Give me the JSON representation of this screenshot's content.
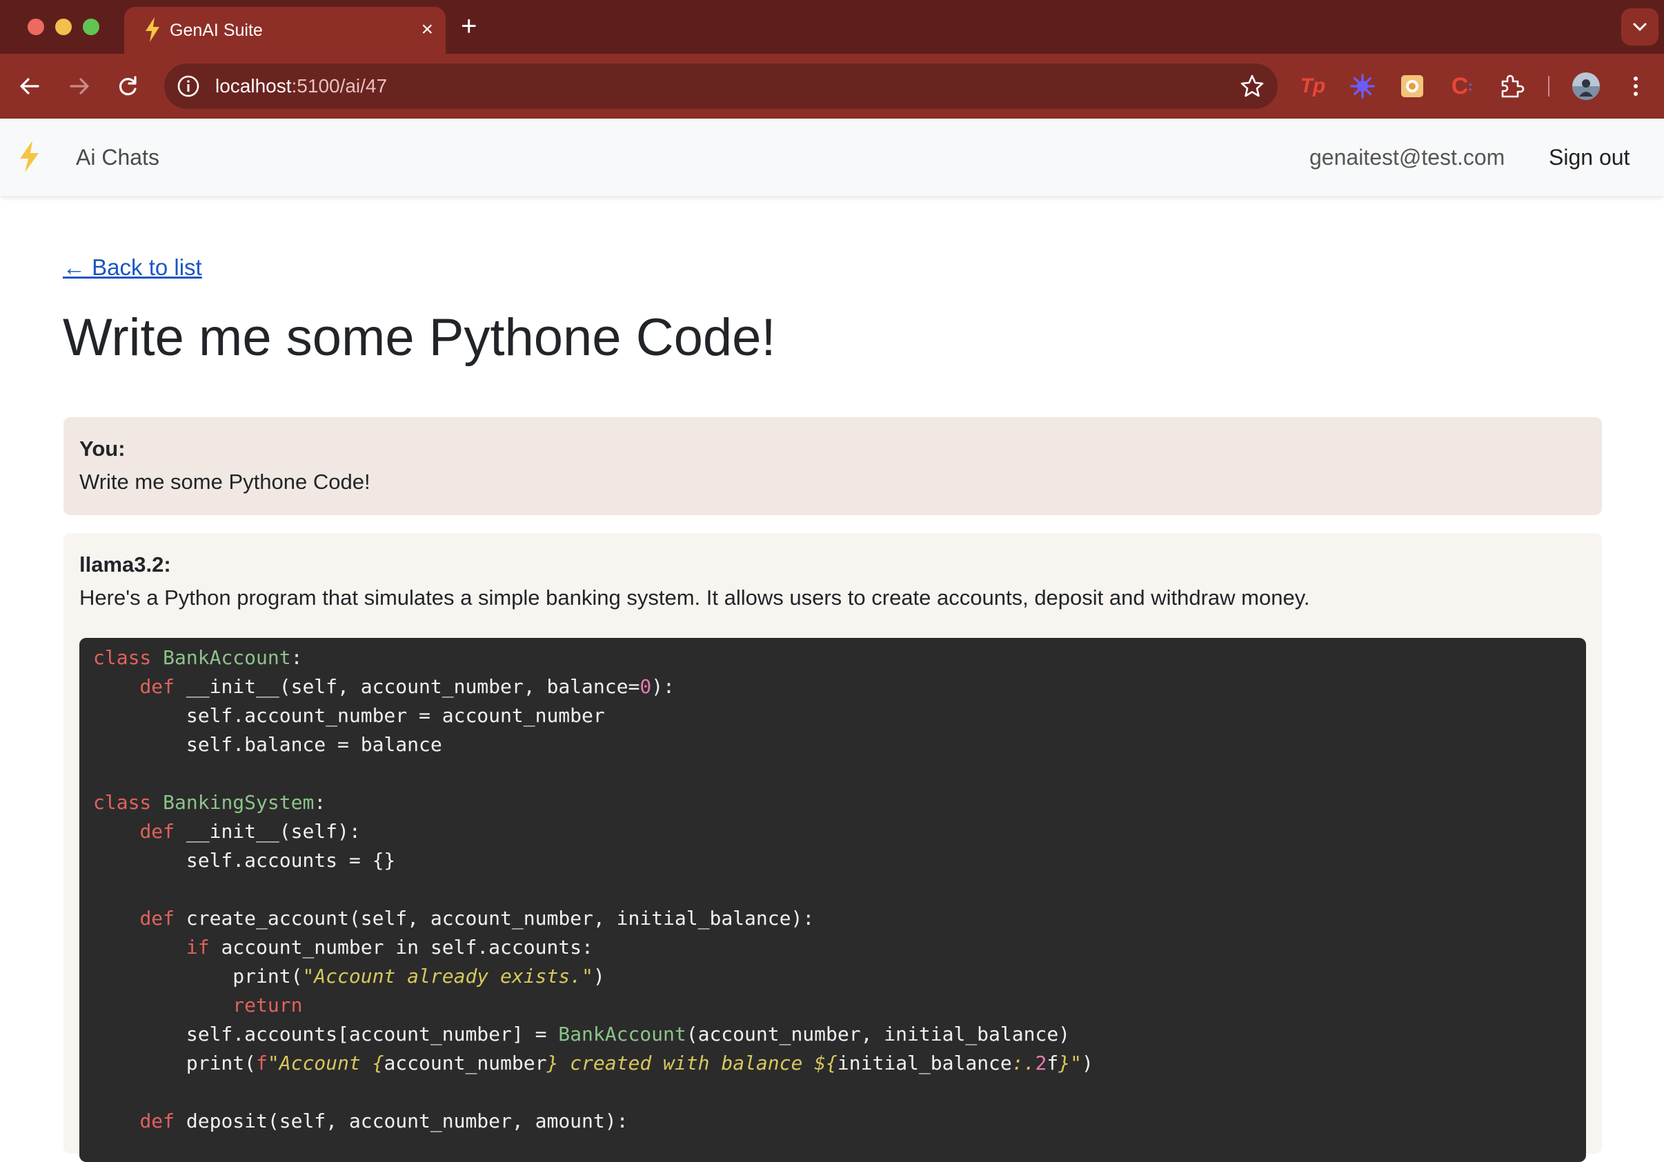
{
  "browser": {
    "tab_title": "GenAI Suite",
    "tab_close": "×",
    "new_tab": "+",
    "url_host": "localhost",
    "url_path": ":5100/ai/47",
    "extensions": [
      "tp-extension-icon",
      "sunburst-extension-icon",
      "camera-extension-icon",
      "c-extension-icon",
      "puzzle-extension-icon",
      "profile-avatar"
    ]
  },
  "appbar": {
    "nav_label": "Ai Chats",
    "user_email": "genaitest@test.com",
    "signout_label": "Sign out"
  },
  "main": {
    "back_label": "← Back to list",
    "title": "Write me some Pythone Code!"
  },
  "messages": {
    "user": {
      "label": "You:",
      "text": "Write me some Pythone Code!"
    },
    "ai": {
      "label": "llama3.2:",
      "text": "Here's a Python program that simulates a simple banking system. It allows users to create accounts, deposit and withdraw money."
    }
  },
  "code_lines": [
    [
      [
        "kw",
        "class "
      ],
      [
        "cls",
        "BankAccount"
      ],
      [
        "p",
        ":"
      ]
    ],
    [
      [
        "p",
        "    "
      ],
      [
        "kw",
        "def "
      ],
      [
        "p",
        "__init__(self, account_number, balance="
      ],
      [
        "num",
        "0"
      ],
      [
        "p",
        "):"
      ]
    ],
    [
      [
        "p",
        "        self.account_number = account_number"
      ]
    ],
    [
      [
        "p",
        "        self.balance = balance"
      ]
    ],
    [],
    [
      [
        "kw",
        "class "
      ],
      [
        "cls",
        "BankingSystem"
      ],
      [
        "p",
        ":"
      ]
    ],
    [
      [
        "p",
        "    "
      ],
      [
        "kw",
        "def "
      ],
      [
        "p",
        "__init__(self):"
      ]
    ],
    [
      [
        "p",
        "        self.accounts = {}"
      ]
    ],
    [],
    [
      [
        "p",
        "    "
      ],
      [
        "kw",
        "def "
      ],
      [
        "p",
        "create_account(self, account_number, initial_balance):"
      ]
    ],
    [
      [
        "p",
        "        "
      ],
      [
        "kw",
        "if "
      ],
      [
        "p",
        "account_number in self.accounts:"
      ]
    ],
    [
      [
        "p",
        "            print("
      ],
      [
        "str",
        "\"Account already exists.\""
      ],
      [
        "p",
        ")"
      ]
    ],
    [
      [
        "p",
        "            "
      ],
      [
        "kw",
        "return"
      ]
    ],
    [
      [
        "p",
        "        self.accounts[account_number] = "
      ],
      [
        "cls",
        "BankAccount"
      ],
      [
        "p",
        "(account_number, initial_balance)"
      ]
    ],
    [
      [
        "p",
        "        print("
      ],
      [
        "kw",
        "f"
      ],
      [
        "str",
        "\"Account {"
      ],
      [
        "p",
        "account_number"
      ],
      [
        "str",
        "} created with balance ${"
      ],
      [
        "p",
        "initial_balance"
      ],
      [
        "str",
        ":."
      ],
      [
        "num",
        "2"
      ],
      [
        "p",
        "f"
      ],
      [
        "str",
        "}\""
      ],
      [
        "p",
        ")"
      ]
    ],
    [],
    [
      [
        "p",
        "    "
      ],
      [
        "kw",
        "def "
      ],
      [
        "p",
        "deposit(self, account_number, amount):"
      ]
    ]
  ]
}
